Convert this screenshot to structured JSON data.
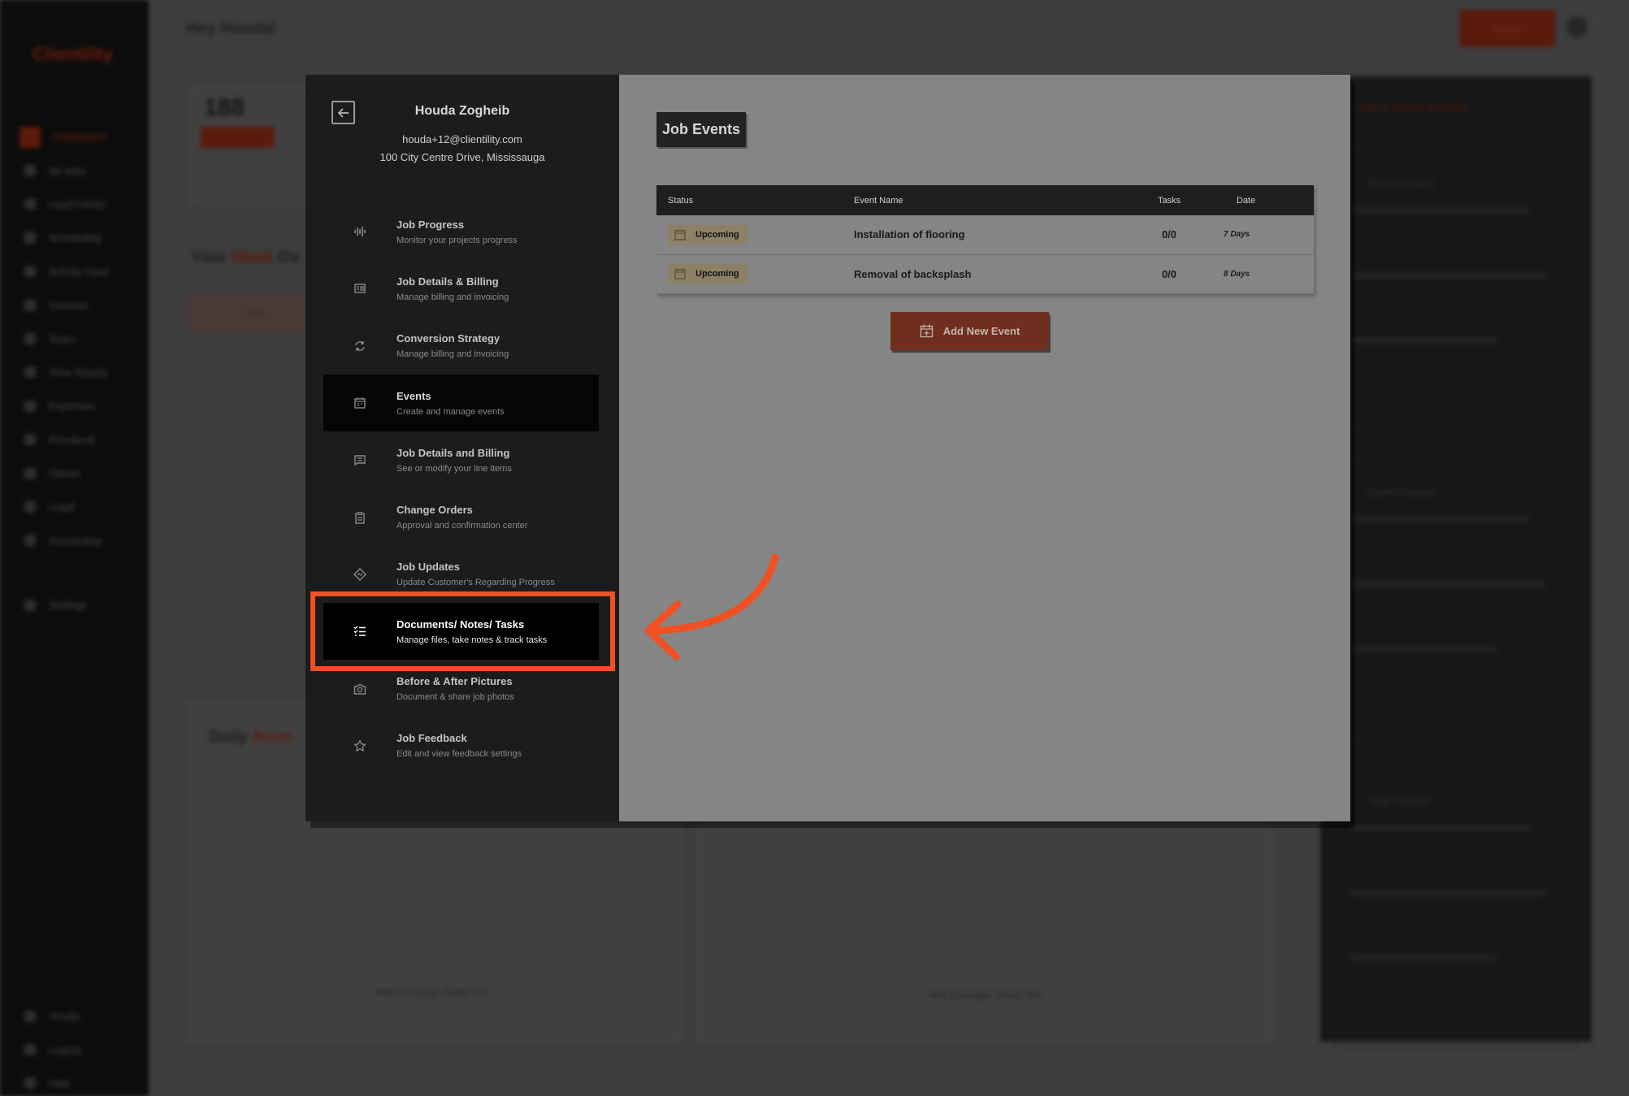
{
  "background": {
    "logo": "Clientility",
    "greeting": "Hey Houda!",
    "event_button": "Event",
    "notification_count": "1",
    "nav_items": [
      "Dashboard",
      "All Jobs",
      "Lead Center",
      "Scheduling",
      "Activity Feed",
      "Invoices",
      "Tasks",
      "Time Sheets",
      "Expenses",
      "Pricebook",
      "Clients",
      "Legal",
      "Accounting"
    ],
    "nav_settings": "Settings",
    "bottom_items": [
      "Houda",
      "Logout",
      "Hide"
    ],
    "stat_value": "188",
    "overview_heading_start": "Your",
    "overview_heading_accent": "Week",
    "overview_heading_end": "Ov",
    "tab_label": "Day",
    "daily_heading_start": "Daily",
    "daily_heading_accent": "Acco",
    "empty_chart_1": "Not Enough Data Yet",
    "empty_chart_2": "Not Enough Data Yet",
    "feed_title": "Job & Event Activity",
    "feed_cards": [
      "Event Created",
      "Event Created",
      "Task Created"
    ]
  },
  "profile": {
    "name": "Houda Zogheib",
    "email": "houda+12@clientility.com",
    "address": "100 City Centre Drive, Mississauga"
  },
  "menu": [
    {
      "title": "Job Progress",
      "subtitle": "Monitor your projects progress",
      "icon": "progress-icon"
    },
    {
      "title": "Job Details & Billing",
      "subtitle": "Manage billing and invoicing",
      "icon": "billing-icon"
    },
    {
      "title": "Conversion Strategy",
      "subtitle": "Manage billing and invoicing",
      "icon": "refresh-icon"
    },
    {
      "title": "Events",
      "subtitle": "Create and manage events",
      "icon": "calendar-icon"
    },
    {
      "title": "Job Details and Billing",
      "subtitle": "See or modify your line items",
      "icon": "message-icon"
    },
    {
      "title": "Change Orders",
      "subtitle": "Approval and confirmation center",
      "icon": "clipboard-icon"
    },
    {
      "title": "Job Updates",
      "subtitle": "Update Customer's Regarding Progress",
      "icon": "diamond-icon"
    },
    {
      "title": "Documents/ Notes/ Tasks",
      "subtitle": "Manage files, take notes & track tasks",
      "icon": "checklist-icon"
    },
    {
      "title": "Before & After Pictures",
      "subtitle": "Document & share job photos",
      "icon": "camera-icon"
    },
    {
      "title": "Job Feedback",
      "subtitle": "Edit and view feedback settings",
      "icon": "star-icon"
    }
  ],
  "content": {
    "title": "Job Events",
    "columns": {
      "status": "Status",
      "name": "Event Name",
      "tasks": "Tasks",
      "date": "Date"
    },
    "rows": [
      {
        "status": "Upcoming",
        "name": "Installation of flooring",
        "tasks": "0/0",
        "date": "7 Days"
      },
      {
        "status": "Upcoming",
        "name": "Removal of backsplash",
        "tasks": "0/0",
        "date": "8 Days"
      }
    ],
    "add_button": "Add New Event"
  },
  "colors": {
    "accent": "#f05124",
    "button": "#6f2e1e",
    "panel": "#1c1c1c"
  }
}
